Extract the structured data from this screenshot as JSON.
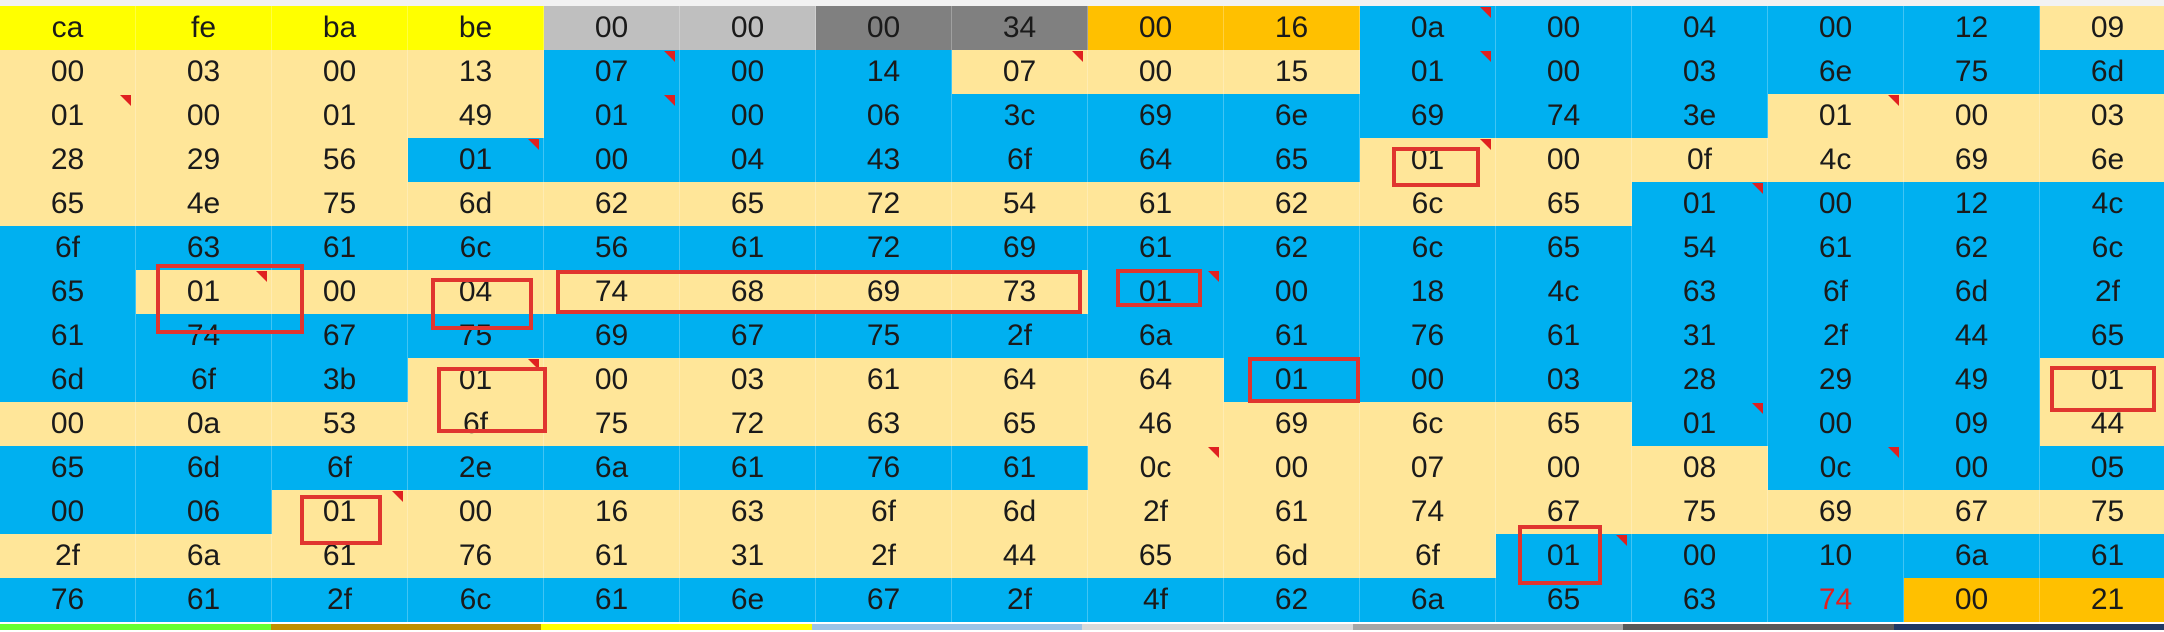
{
  "colors": {
    "yellow": "#ffff00",
    "light_gray": "#bfbfbf",
    "dark_gray": "#808080",
    "orange": "#ffc000",
    "blue": "#00b0f0",
    "cream": "#ffe699",
    "highlight_box": "#e0352f",
    "red_text": "#e02020",
    "comment_marker": "#e02020"
  },
  "sheet": {
    "rows": [
      {
        "cells": [
          {
            "v": "ca",
            "bg": "yellow"
          },
          {
            "v": "fe",
            "bg": "yellow"
          },
          {
            "v": "ba",
            "bg": "yellow"
          },
          {
            "v": "be",
            "bg": "yellow"
          },
          {
            "v": "00",
            "bg": "light_gray"
          },
          {
            "v": "00",
            "bg": "light_gray"
          },
          {
            "v": "00",
            "bg": "dark_gray"
          },
          {
            "v": "34",
            "bg": "dark_gray"
          },
          {
            "v": "00",
            "bg": "orange"
          },
          {
            "v": "16",
            "bg": "orange"
          },
          {
            "v": "0a",
            "bg": "blue",
            "m": 1
          },
          {
            "v": "00",
            "bg": "blue"
          },
          {
            "v": "04",
            "bg": "blue"
          },
          {
            "v": "00",
            "bg": "blue"
          },
          {
            "v": "12",
            "bg": "blue"
          },
          {
            "v": "09",
            "bg": "cream"
          }
        ]
      },
      {
        "cells": [
          {
            "v": "00",
            "bg": "cream"
          },
          {
            "v": "03",
            "bg": "cream"
          },
          {
            "v": "00",
            "bg": "cream"
          },
          {
            "v": "13",
            "bg": "cream"
          },
          {
            "v": "07",
            "bg": "blue",
            "m": 1
          },
          {
            "v": "00",
            "bg": "blue"
          },
          {
            "v": "14",
            "bg": "blue"
          },
          {
            "v": "07",
            "bg": "cream",
            "m": 1
          },
          {
            "v": "00",
            "bg": "cream"
          },
          {
            "v": "15",
            "bg": "cream"
          },
          {
            "v": "01",
            "bg": "blue",
            "m": 1
          },
          {
            "v": "00",
            "bg": "blue"
          },
          {
            "v": "03",
            "bg": "blue"
          },
          {
            "v": "6e",
            "bg": "blue"
          },
          {
            "v": "75",
            "bg": "blue"
          },
          {
            "v": "6d",
            "bg": "blue"
          }
        ]
      },
      {
        "cells": [
          {
            "v": "01",
            "bg": "cream",
            "m": 1
          },
          {
            "v": "00",
            "bg": "cream"
          },
          {
            "v": "01",
            "bg": "cream"
          },
          {
            "v": "49",
            "bg": "cream"
          },
          {
            "v": "01",
            "bg": "blue",
            "m": 1
          },
          {
            "v": "00",
            "bg": "blue"
          },
          {
            "v": "06",
            "bg": "blue"
          },
          {
            "v": "3c",
            "bg": "blue"
          },
          {
            "v": "69",
            "bg": "blue"
          },
          {
            "v": "6e",
            "bg": "blue"
          },
          {
            "v": "69",
            "bg": "blue"
          },
          {
            "v": "74",
            "bg": "blue"
          },
          {
            "v": "3e",
            "bg": "blue"
          },
          {
            "v": "01",
            "bg": "cream",
            "m": 1
          },
          {
            "v": "00",
            "bg": "cream"
          },
          {
            "v": "03",
            "bg": "cream"
          }
        ]
      },
      {
        "cells": [
          {
            "v": "28",
            "bg": "cream"
          },
          {
            "v": "29",
            "bg": "cream"
          },
          {
            "v": "56",
            "bg": "cream"
          },
          {
            "v": "01",
            "bg": "blue",
            "m": 1
          },
          {
            "v": "00",
            "bg": "blue"
          },
          {
            "v": "04",
            "bg": "blue"
          },
          {
            "v": "43",
            "bg": "blue"
          },
          {
            "v": "6f",
            "bg": "blue"
          },
          {
            "v": "64",
            "bg": "blue"
          },
          {
            "v": "65",
            "bg": "blue"
          },
          {
            "v": "01",
            "bg": "cream",
            "m": 1
          },
          {
            "v": "00",
            "bg": "cream"
          },
          {
            "v": "0f",
            "bg": "cream"
          },
          {
            "v": "4c",
            "bg": "cream"
          },
          {
            "v": "69",
            "bg": "cream"
          },
          {
            "v": "6e",
            "bg": "cream"
          }
        ]
      },
      {
        "cells": [
          {
            "v": "65",
            "bg": "cream"
          },
          {
            "v": "4e",
            "bg": "cream"
          },
          {
            "v": "75",
            "bg": "cream"
          },
          {
            "v": "6d",
            "bg": "cream"
          },
          {
            "v": "62",
            "bg": "cream"
          },
          {
            "v": "65",
            "bg": "cream"
          },
          {
            "v": "72",
            "bg": "cream"
          },
          {
            "v": "54",
            "bg": "cream"
          },
          {
            "v": "61",
            "bg": "cream"
          },
          {
            "v": "62",
            "bg": "cream"
          },
          {
            "v": "6c",
            "bg": "cream"
          },
          {
            "v": "65",
            "bg": "cream"
          },
          {
            "v": "01",
            "bg": "blue",
            "m": 1
          },
          {
            "v": "00",
            "bg": "blue"
          },
          {
            "v": "12",
            "bg": "blue"
          },
          {
            "v": "4c",
            "bg": "blue"
          }
        ]
      },
      {
        "cells": [
          {
            "v": "6f",
            "bg": "blue"
          },
          {
            "v": "63",
            "bg": "blue"
          },
          {
            "v": "61",
            "bg": "blue"
          },
          {
            "v": "6c",
            "bg": "blue"
          },
          {
            "v": "56",
            "bg": "blue"
          },
          {
            "v": "61",
            "bg": "blue"
          },
          {
            "v": "72",
            "bg": "blue"
          },
          {
            "v": "69",
            "bg": "blue"
          },
          {
            "v": "61",
            "bg": "blue"
          },
          {
            "v": "62",
            "bg": "blue"
          },
          {
            "v": "6c",
            "bg": "blue"
          },
          {
            "v": "65",
            "bg": "blue"
          },
          {
            "v": "54",
            "bg": "blue"
          },
          {
            "v": "61",
            "bg": "blue"
          },
          {
            "v": "62",
            "bg": "blue"
          },
          {
            "v": "6c",
            "bg": "blue"
          }
        ]
      },
      {
        "cells": [
          {
            "v": "65",
            "bg": "blue"
          },
          {
            "v": "01",
            "bg": "cream",
            "m": 1
          },
          {
            "v": "00",
            "bg": "cream"
          },
          {
            "v": "04",
            "bg": "cream"
          },
          {
            "v": "74",
            "bg": "cream"
          },
          {
            "v": "68",
            "bg": "cream"
          },
          {
            "v": "69",
            "bg": "cream"
          },
          {
            "v": "73",
            "bg": "cream"
          },
          {
            "v": "01",
            "bg": "blue",
            "m": 1
          },
          {
            "v": "00",
            "bg": "blue"
          },
          {
            "v": "18",
            "bg": "blue"
          },
          {
            "v": "4c",
            "bg": "blue"
          },
          {
            "v": "63",
            "bg": "blue"
          },
          {
            "v": "6f",
            "bg": "blue"
          },
          {
            "v": "6d",
            "bg": "blue"
          },
          {
            "v": "2f",
            "bg": "blue"
          }
        ]
      },
      {
        "cells": [
          {
            "v": "61",
            "bg": "blue"
          },
          {
            "v": "74",
            "bg": "blue"
          },
          {
            "v": "67",
            "bg": "blue"
          },
          {
            "v": "75",
            "bg": "blue"
          },
          {
            "v": "69",
            "bg": "blue"
          },
          {
            "v": "67",
            "bg": "blue"
          },
          {
            "v": "75",
            "bg": "blue"
          },
          {
            "v": "2f",
            "bg": "blue"
          },
          {
            "v": "6a",
            "bg": "blue"
          },
          {
            "v": "61",
            "bg": "blue"
          },
          {
            "v": "76",
            "bg": "blue"
          },
          {
            "v": "61",
            "bg": "blue"
          },
          {
            "v": "31",
            "bg": "blue"
          },
          {
            "v": "2f",
            "bg": "blue"
          },
          {
            "v": "44",
            "bg": "blue"
          },
          {
            "v": "65",
            "bg": "blue"
          }
        ]
      },
      {
        "cells": [
          {
            "v": "6d",
            "bg": "blue"
          },
          {
            "v": "6f",
            "bg": "blue"
          },
          {
            "v": "3b",
            "bg": "blue"
          },
          {
            "v": "01",
            "bg": "cream",
            "m": 1
          },
          {
            "v": "00",
            "bg": "cream"
          },
          {
            "v": "03",
            "bg": "cream"
          },
          {
            "v": "61",
            "bg": "cream"
          },
          {
            "v": "64",
            "bg": "cream"
          },
          {
            "v": "64",
            "bg": "cream"
          },
          {
            "v": "01",
            "bg": "blue"
          },
          {
            "v": "00",
            "bg": "blue"
          },
          {
            "v": "03",
            "bg": "blue"
          },
          {
            "v": "28",
            "bg": "blue"
          },
          {
            "v": "29",
            "bg": "blue"
          },
          {
            "v": "49",
            "bg": "blue"
          },
          {
            "v": "01",
            "bg": "cream"
          }
        ]
      },
      {
        "cells": [
          {
            "v": "00",
            "bg": "cream"
          },
          {
            "v": "0a",
            "bg": "cream"
          },
          {
            "v": "53",
            "bg": "cream"
          },
          {
            "v": "6f",
            "bg": "cream"
          },
          {
            "v": "75",
            "bg": "cream"
          },
          {
            "v": "72",
            "bg": "cream"
          },
          {
            "v": "63",
            "bg": "cream"
          },
          {
            "v": "65",
            "bg": "cream"
          },
          {
            "v": "46",
            "bg": "cream"
          },
          {
            "v": "69",
            "bg": "cream"
          },
          {
            "v": "6c",
            "bg": "cream"
          },
          {
            "v": "65",
            "bg": "cream"
          },
          {
            "v": "01",
            "bg": "blue",
            "m": 1
          },
          {
            "v": "00",
            "bg": "blue"
          },
          {
            "v": "09",
            "bg": "blue"
          },
          {
            "v": "44",
            "bg": "cream"
          }
        ]
      },
      {
        "cells": [
          {
            "v": "65",
            "bg": "blue"
          },
          {
            "v": "6d",
            "bg": "blue"
          },
          {
            "v": "6f",
            "bg": "blue"
          },
          {
            "v": "2e",
            "bg": "blue"
          },
          {
            "v": "6a",
            "bg": "blue"
          },
          {
            "v": "61",
            "bg": "blue"
          },
          {
            "v": "76",
            "bg": "blue"
          },
          {
            "v": "61",
            "bg": "blue"
          },
          {
            "v": "0c",
            "bg": "cream",
            "m": 1
          },
          {
            "v": "00",
            "bg": "cream"
          },
          {
            "v": "07",
            "bg": "cream"
          },
          {
            "v": "00",
            "bg": "cream"
          },
          {
            "v": "08",
            "bg": "cream"
          },
          {
            "v": "0c",
            "bg": "blue",
            "m": 1
          },
          {
            "v": "00",
            "bg": "blue"
          },
          {
            "v": "05",
            "bg": "blue"
          }
        ]
      },
      {
        "cells": [
          {
            "v": "00",
            "bg": "blue"
          },
          {
            "v": "06",
            "bg": "blue"
          },
          {
            "v": "01",
            "bg": "cream",
            "m": 1
          },
          {
            "v": "00",
            "bg": "cream"
          },
          {
            "v": "16",
            "bg": "cream"
          },
          {
            "v": "63",
            "bg": "cream"
          },
          {
            "v": "6f",
            "bg": "cream"
          },
          {
            "v": "6d",
            "bg": "cream"
          },
          {
            "v": "2f",
            "bg": "cream"
          },
          {
            "v": "61",
            "bg": "cream"
          },
          {
            "v": "74",
            "bg": "cream"
          },
          {
            "v": "67",
            "bg": "cream"
          },
          {
            "v": "75",
            "bg": "cream"
          },
          {
            "v": "69",
            "bg": "cream"
          },
          {
            "v": "67",
            "bg": "cream"
          },
          {
            "v": "75",
            "bg": "cream"
          }
        ]
      },
      {
        "cells": [
          {
            "v": "2f",
            "bg": "cream"
          },
          {
            "v": "6a",
            "bg": "cream"
          },
          {
            "v": "61",
            "bg": "cream"
          },
          {
            "v": "76",
            "bg": "cream"
          },
          {
            "v": "61",
            "bg": "cream"
          },
          {
            "v": "31",
            "bg": "cream"
          },
          {
            "v": "2f",
            "bg": "cream"
          },
          {
            "v": "44",
            "bg": "cream"
          },
          {
            "v": "65",
            "bg": "cream"
          },
          {
            "v": "6d",
            "bg": "cream"
          },
          {
            "v": "6f",
            "bg": "cream"
          },
          {
            "v": "01",
            "bg": "blue",
            "m": 1
          },
          {
            "v": "00",
            "bg": "blue"
          },
          {
            "v": "10",
            "bg": "blue"
          },
          {
            "v": "6a",
            "bg": "blue"
          },
          {
            "v": "61",
            "bg": "blue"
          }
        ]
      },
      {
        "cells": [
          {
            "v": "76",
            "bg": "blue"
          },
          {
            "v": "61",
            "bg": "blue"
          },
          {
            "v": "2f",
            "bg": "blue"
          },
          {
            "v": "6c",
            "bg": "blue"
          },
          {
            "v": "61",
            "bg": "blue"
          },
          {
            "v": "6e",
            "bg": "blue"
          },
          {
            "v": "67",
            "bg": "blue"
          },
          {
            "v": "2f",
            "bg": "blue"
          },
          {
            "v": "4f",
            "bg": "blue"
          },
          {
            "v": "62",
            "bg": "blue"
          },
          {
            "v": "6a",
            "bg": "blue"
          },
          {
            "v": "65",
            "bg": "blue"
          },
          {
            "v": "63",
            "bg": "blue"
          },
          {
            "v": "74",
            "bg": "blue",
            "red": 1
          },
          {
            "v": "00",
            "bg": "orange"
          },
          {
            "v": "21",
            "bg": "orange"
          }
        ]
      }
    ],
    "bottom_strip": [
      "#66ff33",
      "#bf9000",
      "#ffff00",
      "#9dc3e6",
      "#d9d9d9",
      "#a6a6a6",
      "#595959",
      "#203864"
    ]
  }
}
